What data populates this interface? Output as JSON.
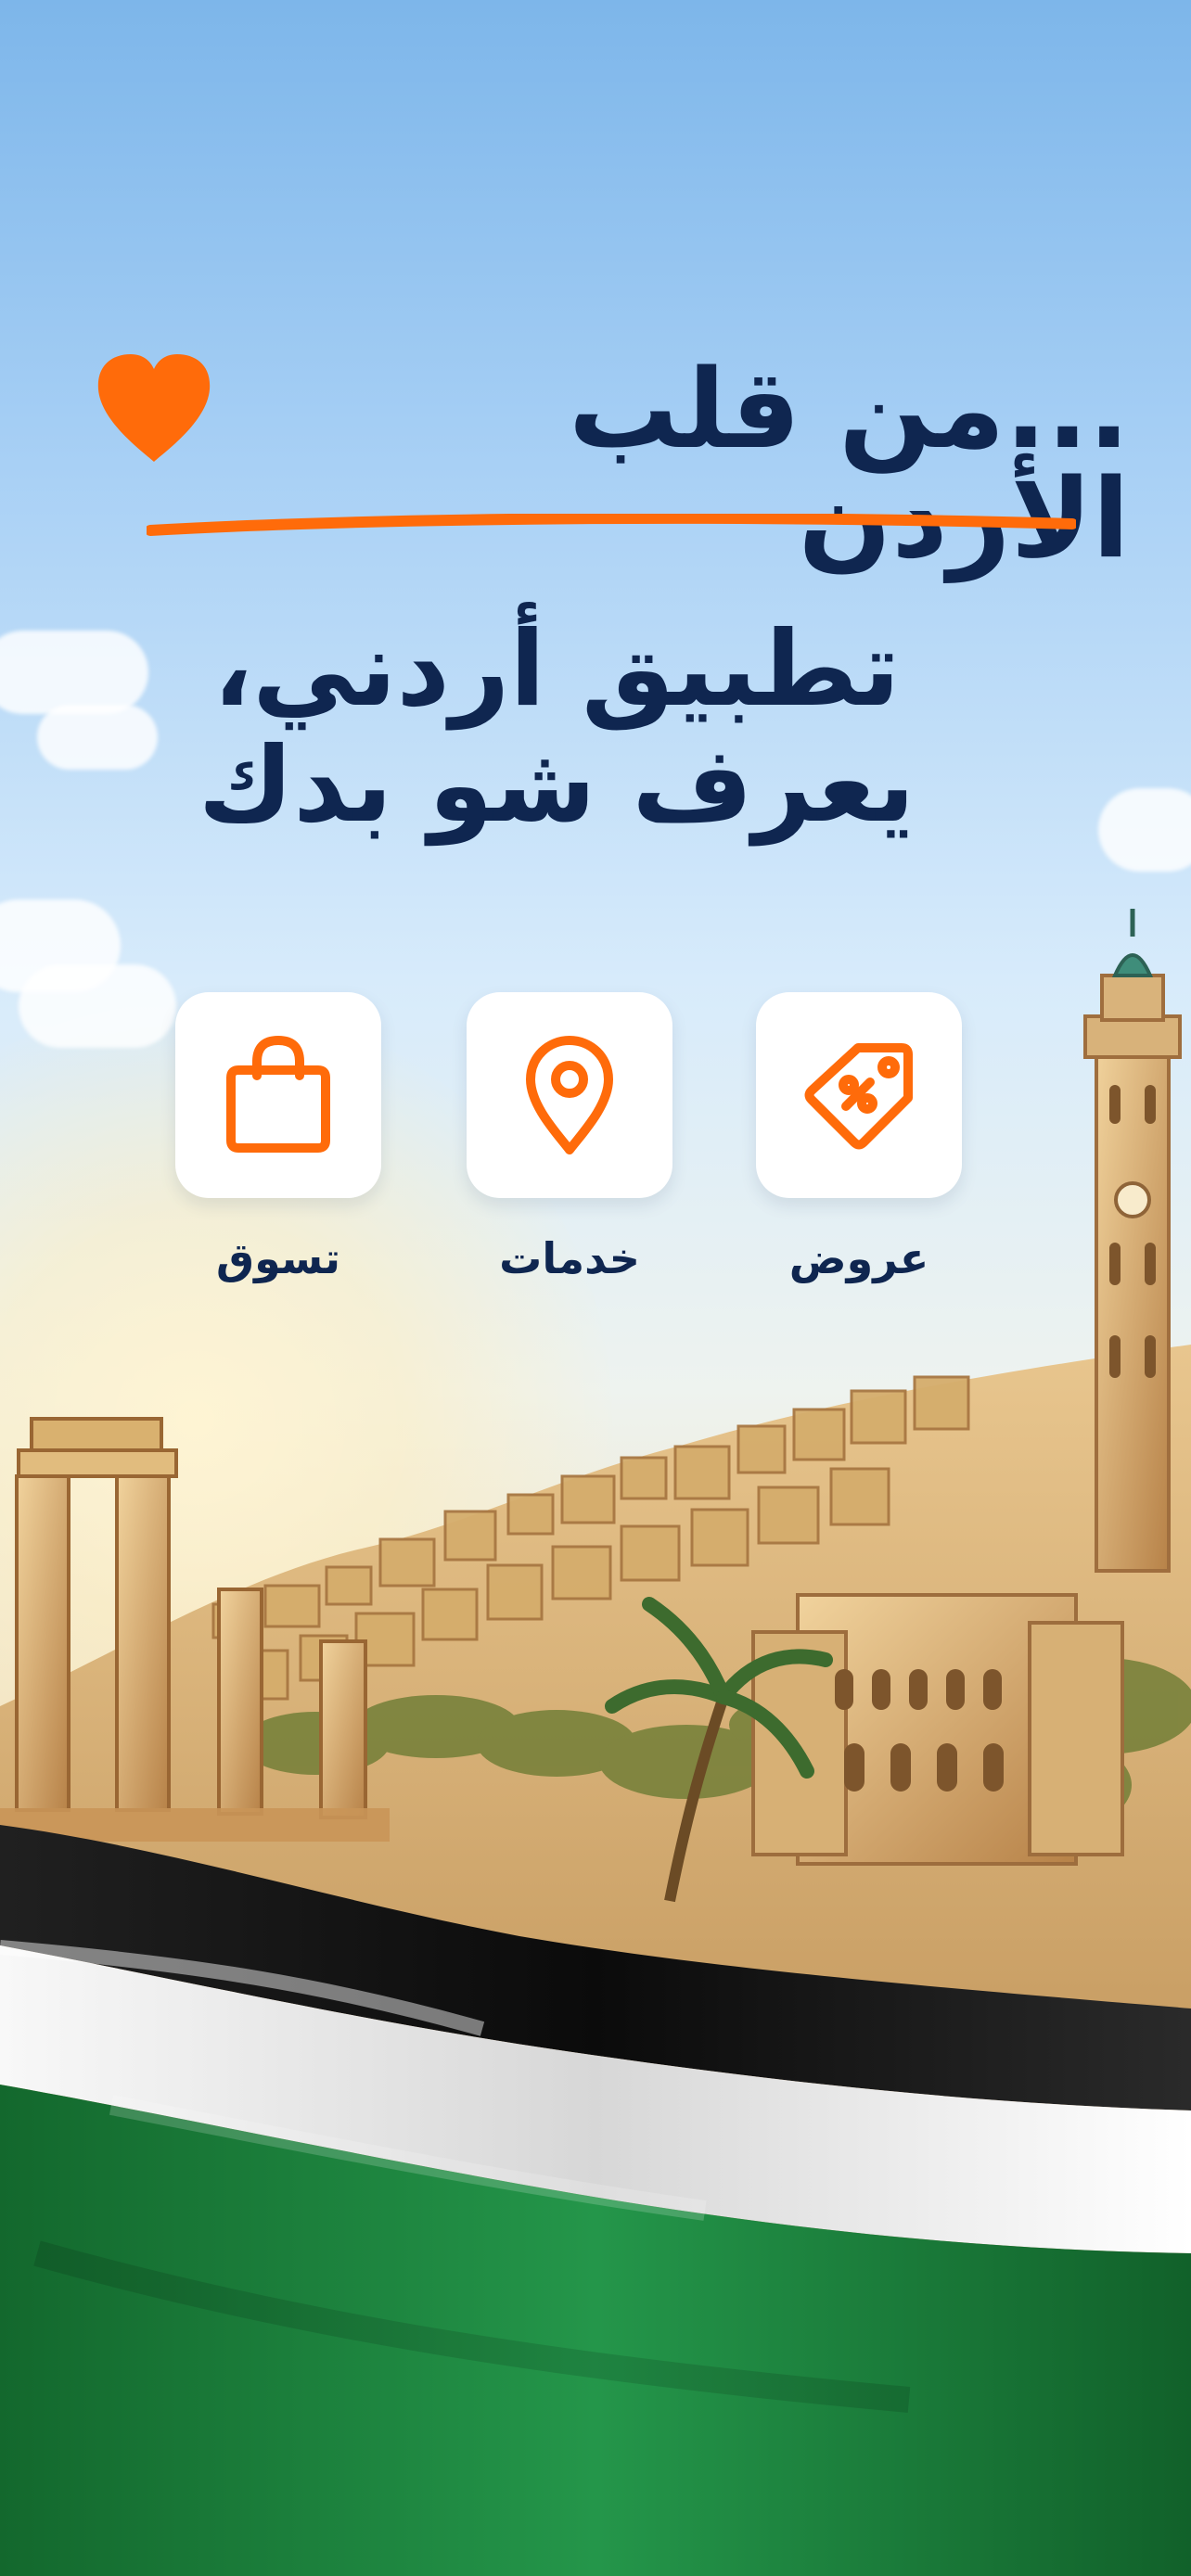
{
  "hero": {
    "headline_line_1": "...من قلب الأردن",
    "headline_line_2": "تطبيق أردني،\nيعرف شو بدك"
  },
  "features": [
    {
      "label": "عروض",
      "icon": "percent-tag-icon"
    },
    {
      "label": "خدمات",
      "icon": "location-pin-icon"
    },
    {
      "label": "تسوق",
      "icon": "shopping-bag-icon"
    }
  ],
  "colors": {
    "accent": "#ff6b0a",
    "navy": "#0f2650",
    "sky_top": "#7db6ea",
    "flag_black": "#111111",
    "flag_white": "#f7f7f7",
    "flag_green": "#1f8a3a"
  }
}
